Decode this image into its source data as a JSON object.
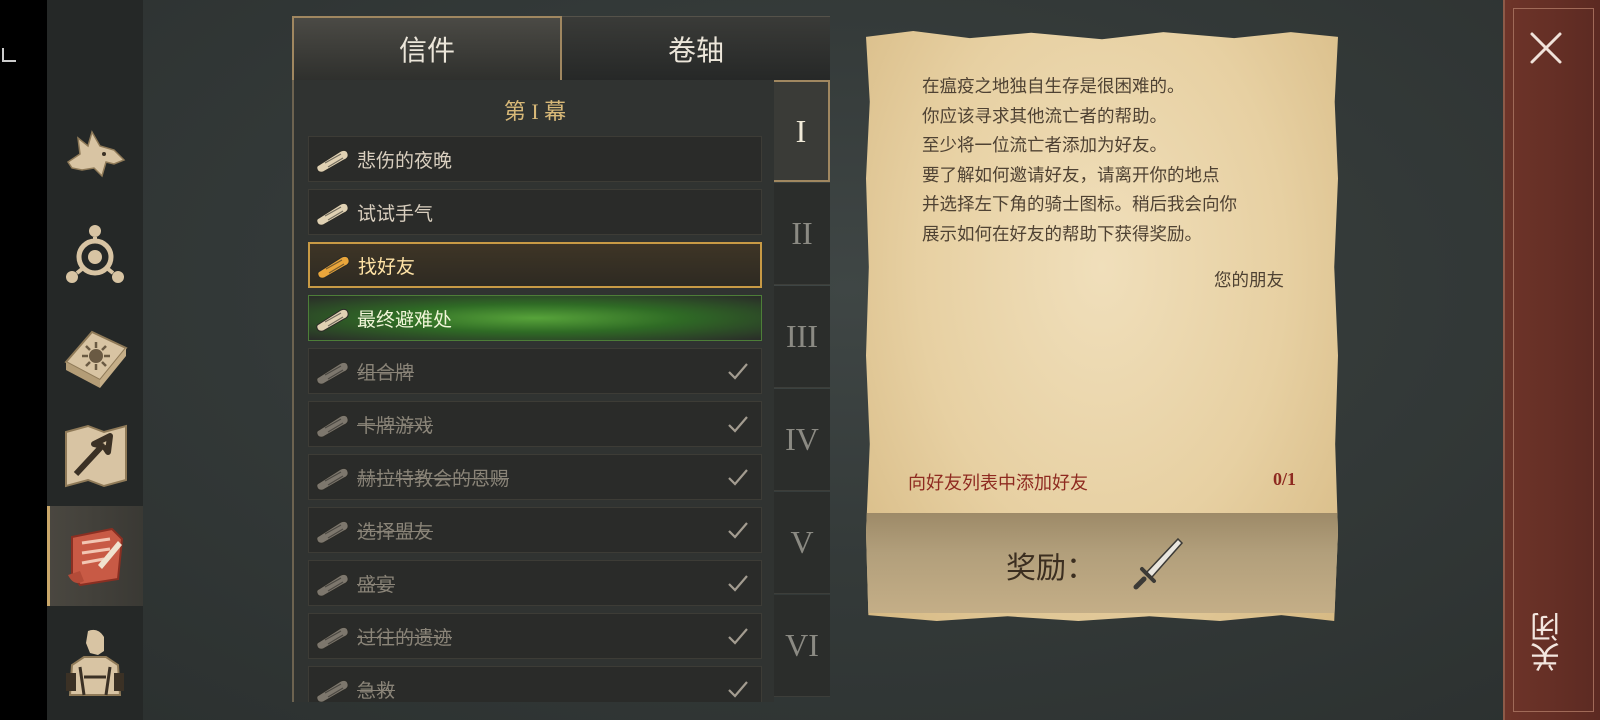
{
  "sidebar": {
    "items": [
      {
        "icon": "wolf-icon"
      },
      {
        "icon": "compass-icon"
      },
      {
        "icon": "book-icon"
      },
      {
        "icon": "map-arrow-icon"
      },
      {
        "icon": "scroll-quest-icon",
        "active": true
      },
      {
        "icon": "character-icon"
      }
    ]
  },
  "tabs": [
    {
      "label": "信件",
      "active": true
    },
    {
      "label": "卷轴",
      "active": false
    }
  ],
  "act": {
    "title": "第 I 幕"
  },
  "quests": [
    {
      "label": "悲伤的夜晚",
      "state": "normal"
    },
    {
      "label": "试试手气",
      "state": "normal"
    },
    {
      "label": "找好友",
      "state": "selected"
    },
    {
      "label": "最终避难处",
      "state": "highlight"
    },
    {
      "label": "组合牌",
      "state": "done"
    },
    {
      "label": "卡牌游戏",
      "state": "done"
    },
    {
      "label": "赫拉特教会的恩赐",
      "state": "done"
    },
    {
      "label": "选择盟友",
      "state": "done"
    },
    {
      "label": "盛宴",
      "state": "done"
    },
    {
      "label": "过往的遗迹",
      "state": "done"
    },
    {
      "label": "急救",
      "state": "done"
    }
  ],
  "chapters": [
    {
      "label": "I",
      "active": true
    },
    {
      "label": "II",
      "active": false
    },
    {
      "label": "III",
      "active": false
    },
    {
      "label": "IV",
      "active": false
    },
    {
      "label": "V",
      "active": false
    },
    {
      "label": "VI",
      "active": false
    }
  ],
  "letter": {
    "lines": [
      "在瘟疫之地独自生存是很困难的。",
      "你应该寻求其他流亡者的帮助。",
      "至少将一位流亡者添加为好友。",
      "要了解如何邀请好友，请离开你的地点",
      "并选择左下角的骑士图标。稍后我会向你",
      "展示如何在好友的帮助下获得奖励。"
    ],
    "signature": "您的朋友",
    "objective": "向好友列表中添加好友",
    "progress": "0/1",
    "reward_label": "奖励：",
    "reward_item_icon": "sword-icon"
  },
  "close": {
    "label": "关闭",
    "icon": "close-icon"
  },
  "colors": {
    "accent_gold": "#c89a45",
    "close_red": "#6e3429",
    "objective_red": "#8e2a20",
    "highlight_green": "#57a33a"
  }
}
